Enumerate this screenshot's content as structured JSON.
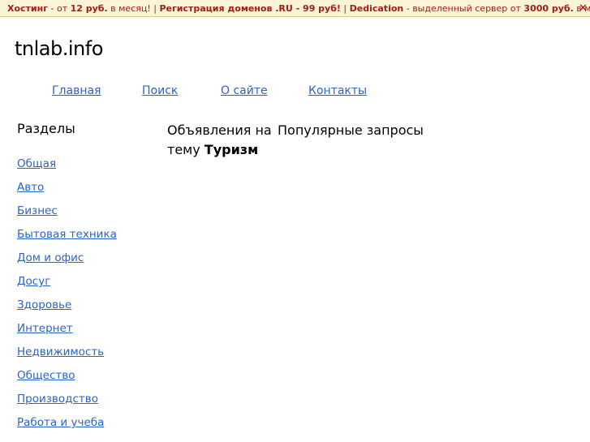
{
  "ad_bar": {
    "hosting_label": "Хостинг",
    "hosting_text_1": " - от ",
    "hosting_price": "12 руб.",
    "hosting_text_2": " в месяц! | ",
    "domains_label": "Регистрация доменов .RU - 99 руб!",
    "sep": " | ",
    "dedication_label": "Dedication",
    "dedication_text_1": " - выделенный сервер от ",
    "dedication_price": "3000 руб.",
    "dedication_text_2": " в месяц",
    "close_symbol": "✕"
  },
  "site": {
    "title": "tnlab.info"
  },
  "topnav": {
    "items": [
      "Главная",
      "Поиск",
      "О сайте",
      "Контакты"
    ]
  },
  "sidebar": {
    "title": "Разделы",
    "items": [
      "Общая",
      "Авто",
      "Бизнес",
      "Бытовая техника",
      "Дом и офис",
      "Досуг",
      "Здоровье",
      "Интернет",
      "Недвижимость",
      "Общество",
      "Производство",
      "Работа и учеба"
    ]
  },
  "main": {
    "ads_heading_prefix": "Объявления на тему ",
    "ads_heading_topic": "Туризм",
    "popular_heading": "Популярные запросы"
  },
  "colors": {
    "link": "#2a63c9",
    "ad_text": "#a31c14",
    "ad_background": "#fcf4d6"
  }
}
